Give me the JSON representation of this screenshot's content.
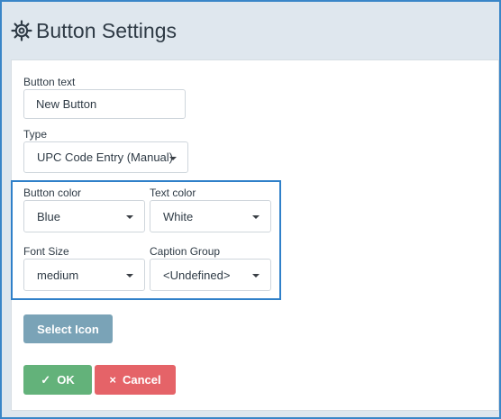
{
  "dialog": {
    "title": "Button Settings",
    "icon": "gear-icon"
  },
  "form": {
    "button_text": {
      "label": "Button text",
      "value": "New Button"
    },
    "type": {
      "label": "Type",
      "value": "UPC Code Entry (Manual)"
    },
    "button_color": {
      "label": "Button color",
      "value": "Blue"
    },
    "text_color": {
      "label": "Text color",
      "value": "White"
    },
    "font_size": {
      "label": "Font Size",
      "value": "medium"
    },
    "caption_group": {
      "label": "Caption Group",
      "value": "<Undefined>"
    }
  },
  "actions": {
    "select_icon": "Select Icon",
    "ok": "OK",
    "cancel": "Cancel",
    "ok_icon": "check-icon",
    "cancel_icon": "close-icon"
  },
  "colors": {
    "accent_border": "#2f80c9",
    "ok": "#63b27a",
    "cancel": "#e56368",
    "select_icon": "#7aa3b7"
  }
}
